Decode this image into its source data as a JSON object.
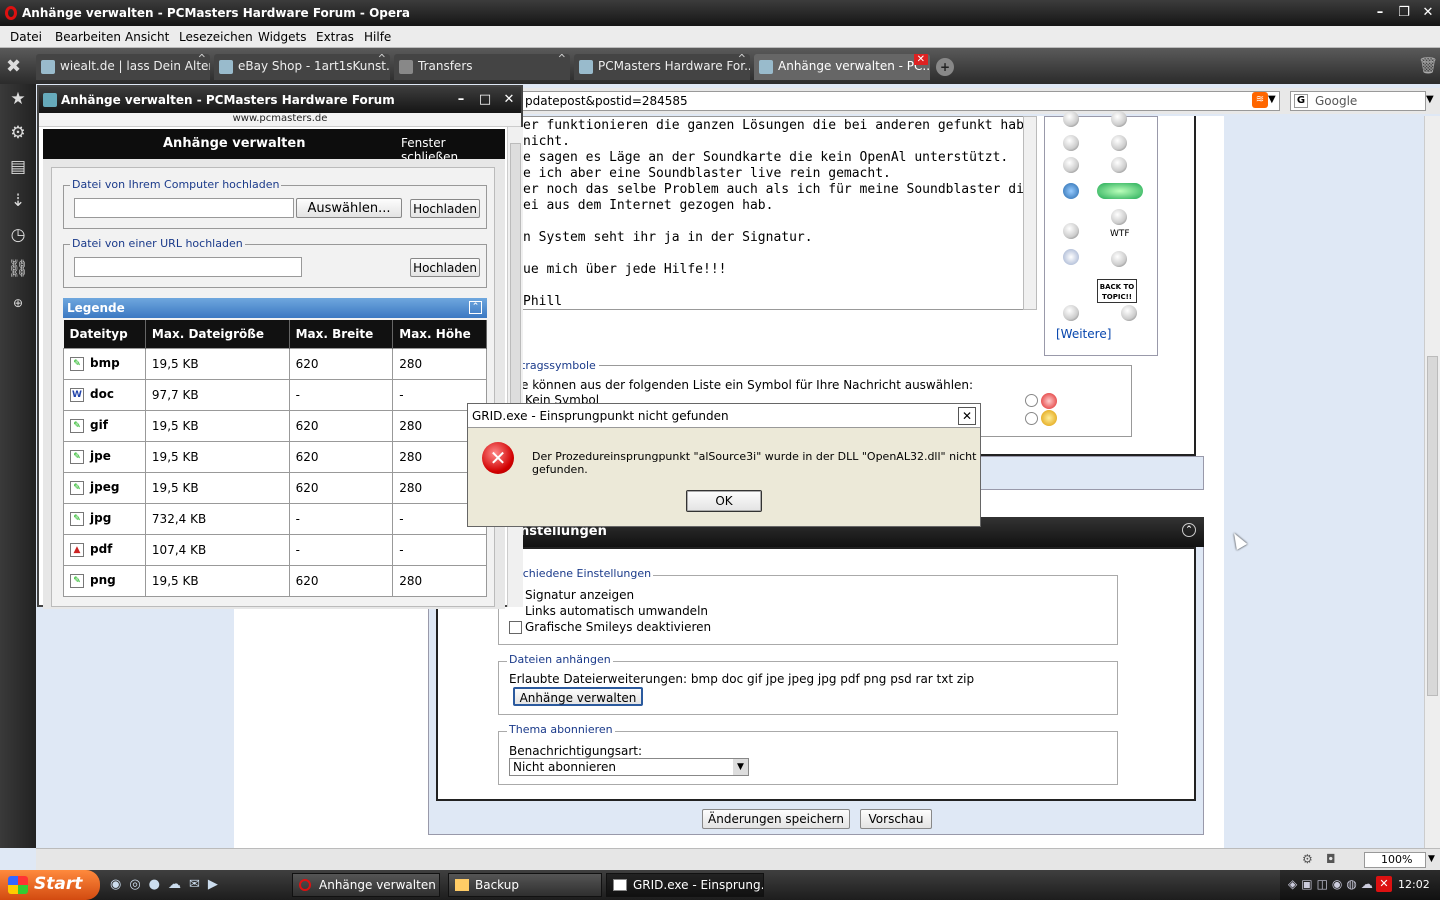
{
  "window": {
    "title": "Anhänge verwalten - PCMasters Hardware Forum - Opera"
  },
  "menu": [
    "Datei",
    "Bearbeiten",
    "Ansicht",
    "Lesezeichen",
    "Widgets",
    "Extras",
    "Hilfe"
  ],
  "tabs": [
    {
      "label": "wiealt.de | lass Dein Alter ..."
    },
    {
      "label": "eBay Shop - 1art1sKunst..."
    },
    {
      "label": "Transfers"
    },
    {
      "label": "PCMasters Hardware For..."
    },
    {
      "label": "Anhänge verwalten - PC..."
    }
  ],
  "address": {
    "url": "pdatepost&postid=284585",
    "search_placeholder": "Google"
  },
  "editor": {
    "text": "er funktionieren die ganzen Lösungen die bei anderen gefunkt haben bei\nnicht.\ne sagen es Läge an der Soundkarte die kein OpenAl unterstützt.\ne ich aber eine Soundblaster live rein gemacht.\ner noch das selbe Problem auch als ich für meine Soundblaster die OpenAl\nei aus dem Internet gezogen hab.\n\nn System seht ihr ja in der Signatur.\n\nue mich über jede Hilfe!!!\n\nPhill"
  },
  "smilies": {
    "more_label": "[Weitere]",
    "wtf_label": "WTF",
    "sign_label": "BACK TO TOPIC!!"
  },
  "symbols": {
    "legend": "tragssymbole",
    "desc": "e können aus der folgenden Liste ein Symbol für Ihre Nachricht auswählen:",
    "none_label": "Kein Symbol"
  },
  "settings": {
    "title": "nstellungen",
    "misc_legend": "schiedene Einstellungen",
    "opt_signature": "Signatur anzeigen",
    "opt_links": "Links automatisch umwandeln",
    "opt_smileys": "Grafische Smileys deaktivieren",
    "attach_legend": "Dateien anhängen",
    "allowed_ext": "Erlaubte Dateierweiterungen: bmp doc gif jpe jpeg jpg pdf png psd rar txt zip",
    "manage_button": "Anhänge verwalten",
    "subscribe_legend": "Thema abonnieren",
    "notify_label": "Benachrichtigungsart:",
    "notify_value": "Nicht abonnieren",
    "save_button": "Änderungen speichern",
    "preview_button": "Vorschau"
  },
  "popup": {
    "title": "Anhänge verwalten - PCMasters Hardware Forum",
    "url": "www.pcmasters.de",
    "heading": "Anhänge verwalten",
    "close_link": "Fenster schließen",
    "upload_legend": "Datei von Ihrem Computer hochladen",
    "choose_button": "Auswählen...",
    "upload_button": "Hochladen",
    "url_legend": "Datei von einer URL hochladen",
    "upload_button2": "Hochladen",
    "legend_title": "Legende",
    "columns": [
      "Dateityp",
      "Max. Dateigröße",
      "Max. Breite",
      "Max. Höhe"
    ],
    "rows": [
      [
        "bmp",
        "19,5 KB",
        "620",
        "280"
      ],
      [
        "doc",
        "97,7 KB",
        "-",
        "-"
      ],
      [
        "gif",
        "19,5 KB",
        "620",
        "280"
      ],
      [
        "jpe",
        "19,5 KB",
        "620",
        "280"
      ],
      [
        "jpeg",
        "19,5 KB",
        "620",
        "280"
      ],
      [
        "jpg",
        "732,4 KB",
        "-",
        "-"
      ],
      [
        "pdf",
        "107,4 KB",
        "-",
        "-"
      ],
      [
        "png",
        "19,5 KB",
        "620",
        "280"
      ]
    ]
  },
  "dialog": {
    "title": "GRID.exe - Einsprungpunkt nicht gefunden",
    "message": "Der Prozedureinsprungpunkt \"alSource3i\" wurde in der DLL \"OpenAL32.dll\" nicht gefunden.",
    "ok": "OK"
  },
  "statusbar": {
    "zoom": "100%"
  },
  "taskbar": {
    "start": "Start",
    "tasks": [
      "Anhänge verwalten - ...",
      "Backup",
      "GRID.exe - Einsprung..."
    ],
    "clock": "12:02"
  },
  "colors": {
    "accent": "#3b78c2",
    "error": "#d10000",
    "start": "#e05a1a"
  }
}
